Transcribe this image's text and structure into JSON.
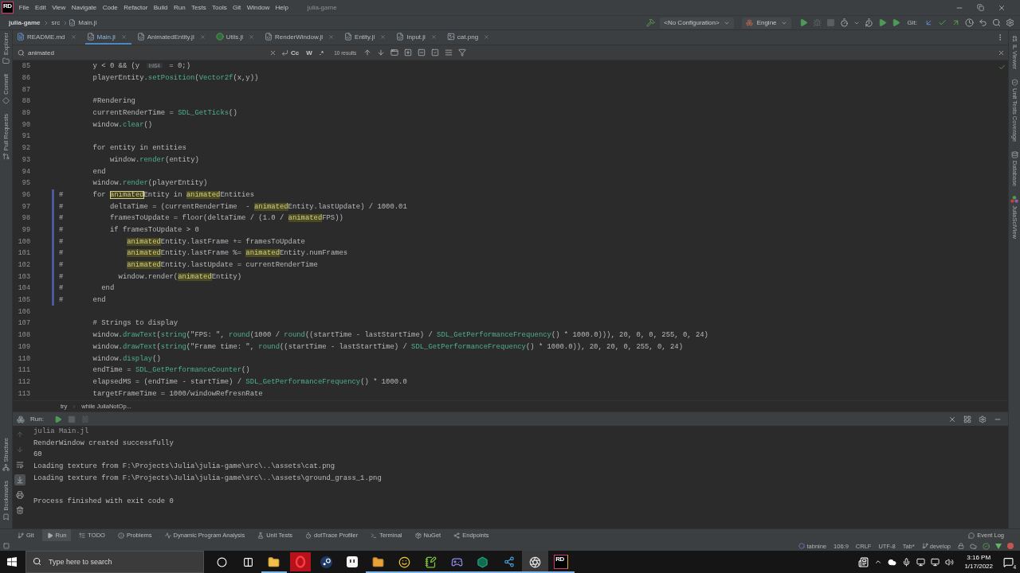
{
  "app": {
    "logo": "RD",
    "menu": [
      "File",
      "Edit",
      "View",
      "Navigate",
      "Code",
      "Refactor",
      "Build",
      "Run",
      "Tests",
      "Tools",
      "Git",
      "Window",
      "Help"
    ],
    "title": "julia-game"
  },
  "breadcrumb": [
    "julia-game",
    "src",
    "Main.jl"
  ],
  "toolbar": {
    "configuration": "<No Configuration>",
    "project": "Engine",
    "actions": [
      {
        "kind": "run",
        "disabled": false
      },
      {
        "kind": "debug",
        "disabled": true
      },
      {
        "kind": "stop",
        "disabled": true
      },
      {
        "kind": "profile",
        "disabled": false
      },
      {
        "kind": "more",
        "disabled": false
      },
      {
        "kind": "attach",
        "disabled": false
      },
      {
        "kind": "coverage",
        "disabled": false
      },
      {
        "kind": "coverage",
        "disabled": false
      }
    ],
    "git_label": "Git:",
    "git_actions": [
      {
        "kind": "update"
      },
      {
        "kind": "commit"
      },
      {
        "kind": "push"
      },
      {
        "kind": "history"
      },
      {
        "kind": "rollback"
      }
    ]
  },
  "left_strip": {
    "top": [
      {
        "label": "Explorer",
        "kind": "explorer"
      },
      {
        "label": "Commit",
        "kind": "commit"
      },
      {
        "label": "Pull Requests",
        "kind": "pull_requests"
      }
    ],
    "bottom": [
      {
        "label": "Structure",
        "kind": "structure"
      },
      {
        "label": "Bookmarks",
        "kind": "bookmarks"
      }
    ]
  },
  "right_strip": [
    {
      "label": "IL Viewer",
      "kind": "il"
    },
    {
      "label": "Unit Tests Coverage",
      "kind": "coverage"
    },
    {
      "label": "Database",
      "kind": "database"
    },
    {
      "label": "JuliaSciView",
      "kind": "dots"
    }
  ],
  "tabs": [
    {
      "label": "README.md",
      "kind": "markdown",
      "selected": false
    },
    {
      "label": "Main.jl",
      "kind": "julia",
      "selected": true
    },
    {
      "label": "AnimatedEntity.jl",
      "kind": "julia",
      "selected": false
    },
    {
      "label": "Utils.jl",
      "kind": "circle",
      "selected": false
    },
    {
      "label": "RenderWindow.jl",
      "kind": "julia",
      "selected": false
    },
    {
      "label": "Entity.jl",
      "kind": "julia",
      "selected": false
    },
    {
      "label": "Input.jl",
      "kind": "julia",
      "selected": false
    },
    {
      "label": "cat.png",
      "kind": "image",
      "selected": false
    }
  ],
  "search": {
    "value": "animated",
    "options": [
      "Cc",
      "W",
      ".*"
    ],
    "results": "10 results"
  },
  "editor": {
    "lines": [
      {
        "number": "85",
        "changed": false,
        "segments": [
          {
            "text": "        y < 0 && (y ",
            "kind": "code"
          },
          {
            "text": "Int64",
            "kind": "hint"
          },
          {
            "text": " = 0;)",
            "kind": "code"
          }
        ]
      },
      {
        "number": "86",
        "changed": false,
        "segments": [
          {
            "text": "        playerEntity.",
            "kind": "code"
          },
          {
            "text": "setPosition",
            "kind": "call"
          },
          {
            "text": "(",
            "kind": "code"
          },
          {
            "text": "Vector2f",
            "kind": "call"
          },
          {
            "text": "(x,y))",
            "kind": "code"
          }
        ]
      },
      {
        "number": "87",
        "changed": false
      },
      {
        "number": "88",
        "changed": false,
        "segments": [
          {
            "text": "        #Rendering",
            "kind": "code"
          }
        ]
      },
      {
        "number": "89",
        "changed": false,
        "segments": [
          {
            "text": "        currentRenderTime = ",
            "kind": "code"
          },
          {
            "text": "SDL_GetTicks",
            "kind": "call"
          },
          {
            "text": "()",
            "kind": "code"
          }
        ]
      },
      {
        "number": "90",
        "changed": false,
        "segments": [
          {
            "text": "        window.",
            "kind": "code"
          },
          {
            "text": "clear",
            "kind": "call"
          },
          {
            "text": "()",
            "kind": "code"
          }
        ]
      },
      {
        "number": "91",
        "changed": false
      },
      {
        "number": "92",
        "changed": false,
        "segments": [
          {
            "text": "        for entity in entities",
            "kind": "code"
          }
        ]
      },
      {
        "number": "93",
        "changed": false,
        "segments": [
          {
            "text": "            window.",
            "kind": "code"
          },
          {
            "text": "render",
            "kind": "call"
          },
          {
            "text": "(entity)",
            "kind": "code"
          }
        ]
      },
      {
        "number": "94",
        "changed": false,
        "segments": [
          {
            "text": "        end",
            "kind": "code"
          }
        ]
      },
      {
        "number": "95",
        "changed": false,
        "segments": [
          {
            "text": "        window.",
            "kind": "code"
          },
          {
            "text": "render",
            "kind": "call"
          },
          {
            "text": "(playerEntity)",
            "kind": "code"
          }
        ]
      },
      {
        "number": "96",
        "changed": true,
        "segments": [
          {
            "text": "#       for ",
            "kind": "code"
          },
          {
            "text": "animated",
            "kind": "current"
          },
          {
            "text": "Entity in ",
            "kind": "code"
          },
          {
            "text": "animated",
            "kind": "match"
          },
          {
            "text": "Entities",
            "kind": "code"
          }
        ]
      },
      {
        "number": "97",
        "changed": true,
        "segments": [
          {
            "text": "#           deltaTime = (currentRenderTime  - ",
            "kind": "code"
          },
          {
            "text": "animated",
            "kind": "match"
          },
          {
            "text": "Entity.lastUpdate) / 1000.01",
            "kind": "code"
          }
        ]
      },
      {
        "number": "98",
        "changed": true,
        "segments": [
          {
            "text": "#           framesToUpdate = floor(deltaTime / (1.0 / ",
            "kind": "code"
          },
          {
            "text": "animated",
            "kind": "match"
          },
          {
            "text": "FPS))",
            "kind": "code"
          }
        ]
      },
      {
        "number": "99",
        "changed": true,
        "segments": [
          {
            "text": "#           if framesToUpdate > 0",
            "kind": "code"
          }
        ]
      },
      {
        "number": "100",
        "changed": true,
        "segments": [
          {
            "text": "#               ",
            "kind": "code"
          },
          {
            "text": "animated",
            "kind": "match"
          },
          {
            "text": "Entity.lastFrame += framesToUpdate",
            "kind": "code"
          }
        ]
      },
      {
        "number": "101",
        "changed": true,
        "segments": [
          {
            "text": "#               ",
            "kind": "code"
          },
          {
            "text": "animated",
            "kind": "match"
          },
          {
            "text": "Entity.lastFrame %= ",
            "kind": "code"
          },
          {
            "text": "animated",
            "kind": "match"
          },
          {
            "text": "Entity.numFrames",
            "kind": "code"
          }
        ]
      },
      {
        "number": "102",
        "changed": true,
        "segments": [
          {
            "text": "#               ",
            "kind": "code"
          },
          {
            "text": "animated",
            "kind": "match"
          },
          {
            "text": "Entity.lastUpdate = currentRenderTime",
            "kind": "code"
          }
        ]
      },
      {
        "number": "103",
        "changed": true,
        "segments": [
          {
            "text": "#             window.render(",
            "kind": "code"
          },
          {
            "text": "animated",
            "kind": "match"
          },
          {
            "text": "Entity)",
            "kind": "code"
          }
        ]
      },
      {
        "number": "104",
        "changed": true,
        "segments": [
          {
            "text": "#         end",
            "kind": "code"
          }
        ]
      },
      {
        "number": "105",
        "changed": true,
        "segments": [
          {
            "text": "#       end",
            "kind": "code"
          }
        ]
      },
      {
        "number": "106",
        "changed": false
      },
      {
        "number": "107",
        "changed": false,
        "segments": [
          {
            "text": "        # Strings to display",
            "kind": "code"
          }
        ]
      },
      {
        "number": "108",
        "changed": false,
        "segments": [
          {
            "text": "        window.",
            "kind": "code"
          },
          {
            "text": "drawText",
            "kind": "call"
          },
          {
            "text": "(",
            "kind": "code"
          },
          {
            "text": "string",
            "kind": "call"
          },
          {
            "text": "(\"FPS: \", ",
            "kind": "code"
          },
          {
            "text": "round",
            "kind": "call"
          },
          {
            "text": "(1000 / ",
            "kind": "code"
          },
          {
            "text": "round",
            "kind": "call"
          },
          {
            "text": "((startTime - lastStartTime) / ",
            "kind": "code"
          },
          {
            "text": "SDL_GetPerformanceFrequency",
            "kind": "call"
          },
          {
            "text": "() * 1000.0))), 20, 0, 0, 255, 0, 24)",
            "kind": "code"
          }
        ]
      },
      {
        "number": "109",
        "changed": false,
        "segments": [
          {
            "text": "        window.",
            "kind": "code"
          },
          {
            "text": "drawText",
            "kind": "call"
          },
          {
            "text": "(",
            "kind": "code"
          },
          {
            "text": "string",
            "kind": "call"
          },
          {
            "text": "(\"Frame time: \", ",
            "kind": "code"
          },
          {
            "text": "round",
            "kind": "call"
          },
          {
            "text": "((startTime - lastStartTime) / ",
            "kind": "code"
          },
          {
            "text": "SDL_GetPerformanceFrequency",
            "kind": "call"
          },
          {
            "text": "() * 1000.0)), 20, 20, 0, 255, 0, 24)",
            "kind": "code"
          }
        ]
      },
      {
        "number": "110",
        "changed": false,
        "segments": [
          {
            "text": "        window.",
            "kind": "code"
          },
          {
            "text": "display",
            "kind": "call"
          },
          {
            "text": "()",
            "kind": "code"
          }
        ]
      },
      {
        "number": "111",
        "changed": false,
        "segments": [
          {
            "text": "        endTime = ",
            "kind": "code"
          },
          {
            "text": "SDL_GetPerformanceCounter",
            "kind": "call"
          },
          {
            "text": "()",
            "kind": "code"
          }
        ]
      },
      {
        "number": "112",
        "changed": false,
        "segments": [
          {
            "text": "        elapsedMS = (endTime - startTime) / ",
            "kind": "code"
          },
          {
            "text": "SDL_GetPerformanceFrequency",
            "kind": "call"
          },
          {
            "text": "() * 1000.0",
            "kind": "code"
          }
        ]
      },
      {
        "number": "113",
        "changed": false,
        "segments": [
          {
            "text": "        targetFrameTime = 1000/windowRefresnRate",
            "kind": "code"
          }
        ]
      }
    ],
    "breadcrumb": [
      "try",
      "while JuliaNotOp..."
    ]
  },
  "run": {
    "title": "Run:",
    "controls": [
      {
        "kind": "rerun",
        "disabled": false
      },
      {
        "kind": "stop",
        "disabled": true
      },
      {
        "kind": "pause",
        "disabled": true
      }
    ],
    "side_tools": [
      {
        "kind": "up",
        "disabled": true,
        "selected": false
      },
      {
        "kind": "down",
        "disabled": true,
        "selected": false
      },
      {
        "kind": "wrap",
        "disabled": false,
        "selected": false
      },
      {
        "kind": "scroll_end",
        "disabled": false,
        "selected": true
      },
      {
        "kind": "print",
        "disabled": false,
        "selected": false
      },
      {
        "kind": "trash",
        "disabled": false,
        "selected": false
      }
    ],
    "command": "julia Main.jl",
    "output": [
      "RenderWindow created successfully",
      "60",
      "Loading texture from F:\\Projects\\Julia\\julia-game\\src\\..\\assets\\cat.png",
      "Loading texture from F:\\Projects\\Julia\\julia-game\\src\\..\\assets\\ground_grass_1.png"
    ],
    "exit": "Process finished with exit code 0"
  },
  "tool_windows": [
    {
      "label": "Git",
      "kind": "git",
      "selected": false
    },
    {
      "label": "Run",
      "kind": "run",
      "selected": true
    },
    {
      "label": "TODO",
      "kind": "todo",
      "selected": false
    },
    {
      "label": "Problems",
      "kind": "problems",
      "selected": false
    },
    {
      "label": "Dynamic Program Analysis",
      "kind": "dpa",
      "selected": false
    },
    {
      "label": "Unit Tests",
      "kind": "tests",
      "selected": false
    },
    {
      "label": "dotTrace Profiler",
      "kind": "profiler",
      "selected": false
    },
    {
      "label": "Terminal",
      "kind": "terminal",
      "selected": false
    },
    {
      "label": "NuGet",
      "kind": "nuget",
      "selected": false
    },
    {
      "label": "Endpoints",
      "kind": "endpoints",
      "selected": false
    }
  ],
  "event_log": "Event Log",
  "status_bar": {
    "plugin": "tabnine",
    "position": "106:9",
    "line_separator": "CRLF",
    "encoding": "UTF-8",
    "indent": "Tab*",
    "branch": "develop"
  },
  "taskbar": {
    "search_placeholder": "Type here to search",
    "apps": [
      {
        "kind": "cortana",
        "active": false,
        "running": false
      },
      {
        "kind": "task_view",
        "active": false,
        "running": false
      },
      {
        "kind": "explorer",
        "active": false,
        "running": true
      },
      {
        "kind": "ring",
        "active": false,
        "running": false
      },
      {
        "kind": "disc",
        "active": false,
        "running": false
      },
      {
        "kind": "face",
        "active": false,
        "running": false
      },
      {
        "kind": "folder",
        "active": false,
        "running": true
      },
      {
        "kind": "smiley",
        "active": false,
        "running": true
      },
      {
        "kind": "notepad",
        "active": false,
        "running": true
      },
      {
        "kind": "gamepad",
        "active": false,
        "running": true
      },
      {
        "kind": "hexagon",
        "active": false,
        "running": true
      },
      {
        "kind": "nodes",
        "active": false,
        "running": true
      },
      {
        "kind": "aperture",
        "active": true,
        "running": true
      },
      {
        "kind": "logo",
        "glyph": "RD",
        "active": false,
        "running": true
      }
    ],
    "time": "3:16 PM",
    "date": "1/17/2022",
    "notifications": "4"
  }
}
